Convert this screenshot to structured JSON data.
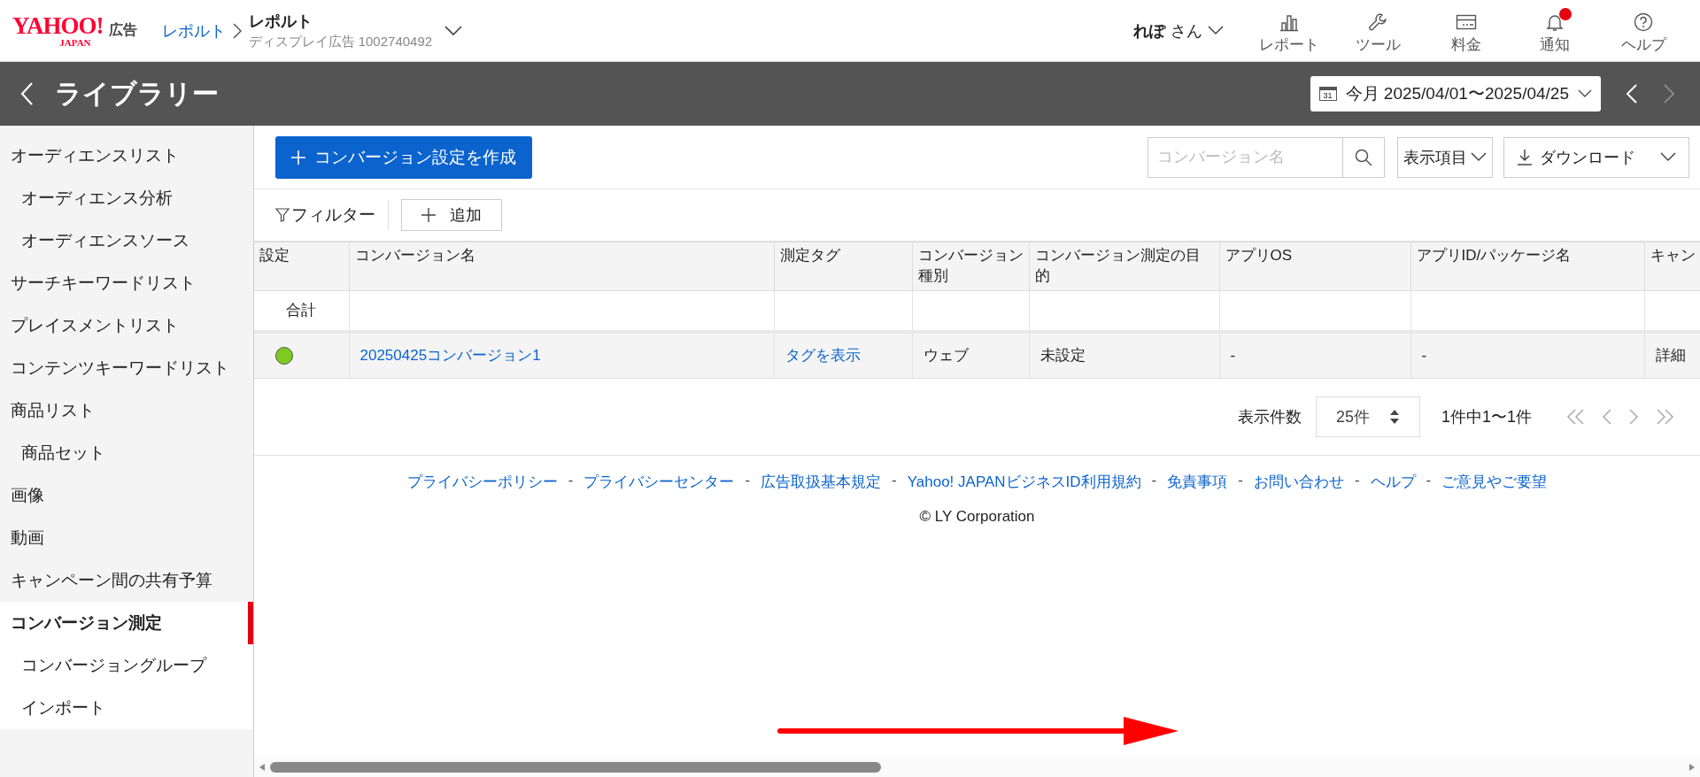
{
  "header": {
    "logo": {
      "brand": "YAHOO!",
      "sub": "JAPAN",
      "product": "広告"
    },
    "breadcrumb": {
      "link": "レポルト",
      "title": "レポルト",
      "subtitle": "ディスプレイ広告 1002740492"
    },
    "user": {
      "name": "れぽ",
      "suffix": "さん"
    },
    "nav": [
      {
        "kind": "chart",
        "label": "レポート",
        "badge": false
      },
      {
        "kind": "wrench",
        "label": "ツール",
        "badge": false
      },
      {
        "kind": "card",
        "label": "料金",
        "badge": false
      },
      {
        "kind": "bell",
        "label": "通知",
        "badge": true
      },
      {
        "kind": "help",
        "label": "ヘルプ",
        "badge": false
      }
    ]
  },
  "page_bar": {
    "title": "ライブラリー",
    "date_range": {
      "label": "今月",
      "range": "2025/04/01〜2025/04/25",
      "calendar_day": "31"
    },
    "prev_disabled": false,
    "next_disabled": true
  },
  "sidebar": {
    "items": [
      {
        "label": "オーディエンスリスト",
        "selected": false,
        "children": [
          {
            "label": "オーディエンス分析",
            "selected": false
          },
          {
            "label": "オーディエンスソース",
            "selected": false
          }
        ]
      },
      {
        "label": "サーチキーワードリスト",
        "selected": false
      },
      {
        "label": "プレイスメントリスト",
        "selected": false
      },
      {
        "label": "コンテンツキーワードリスト",
        "selected": false
      },
      {
        "label": "商品リスト",
        "selected": false,
        "children": [
          {
            "label": "商品セット",
            "selected": false
          }
        ]
      },
      {
        "label": "画像",
        "selected": false
      },
      {
        "label": "動画",
        "selected": false
      },
      {
        "label": "キャンペーン間の共有予算",
        "selected": false
      },
      {
        "label": "コンバージョン測定",
        "selected": true,
        "children": [
          {
            "label": "コンバージョングループ",
            "selected": false
          },
          {
            "label": "インポート",
            "selected": false
          }
        ]
      }
    ]
  },
  "toolbar": {
    "create_button": "コンバージョン設定を作成",
    "search": {
      "placeholder": "コンバージョン名"
    },
    "columns_dropdown": "表示項目",
    "download_dropdown": "ダウンロード"
  },
  "filter_bar": {
    "filter": "フィルター",
    "add": "追加"
  },
  "table": {
    "columns": [
      "設定",
      "コンバージョン名",
      "測定タグ",
      "コンバージョン種別",
      "コンバージョン測定の目的",
      "アプリOS",
      "アプリID/パッケージ名",
      "キャン"
    ],
    "total_row": {
      "label": "合計"
    },
    "rows": [
      {
        "color": "#7ccb1e",
        "name": "20250425コンバージョン1",
        "tag": "タグを表示",
        "type": "ウェブ",
        "purpose": "未設定",
        "os": "-",
        "app_id": "-",
        "column_8": "詳細"
      }
    ]
  },
  "pagination": {
    "per_page_label": "表示件数",
    "per_page": "25件",
    "summary": "1件中1〜1件",
    "first_disabled": true,
    "prev_disabled": true,
    "next_disabled": true,
    "last_disabled": true
  },
  "footer": {
    "links": [
      "プライバシーポリシー",
      "プライバシーセンター",
      "広告取扱基本規定",
      "Yahoo! JAPANビジネスID利用規約",
      "免責事項",
      "お問い合わせ",
      "ヘルプ",
      "ご意見やご要望"
    ],
    "separator": "-",
    "copyright": "© LY Corporation"
  }
}
